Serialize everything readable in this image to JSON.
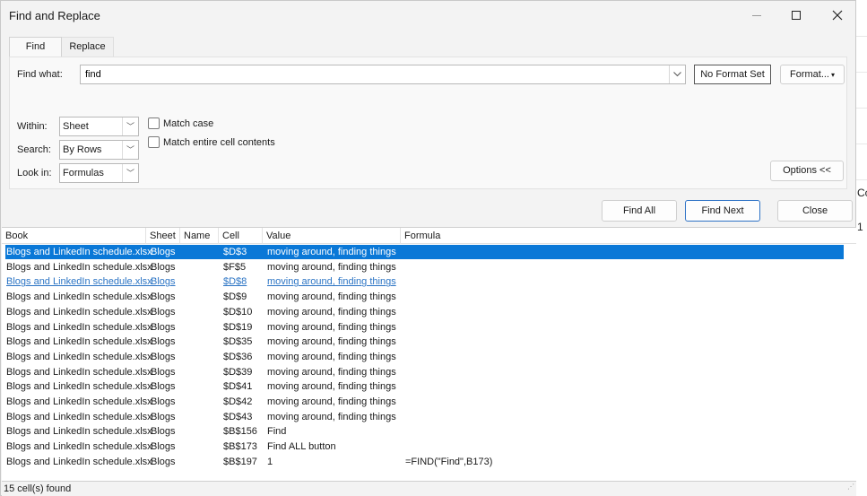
{
  "window": {
    "title": "Find and Replace"
  },
  "tabs": [
    {
      "label": "Find",
      "active": true
    },
    {
      "label": "Replace",
      "active": false
    }
  ],
  "find": {
    "label": "Find what:",
    "value": "find",
    "format_status": "No Format Set",
    "format_button": "Format..."
  },
  "options": {
    "within": {
      "label": "Within:",
      "value": "Sheet"
    },
    "search": {
      "label": "Search:",
      "value": "By Rows"
    },
    "lookin": {
      "label": "Look in:",
      "value": "Formulas"
    },
    "match_case": {
      "label": "Match case",
      "checked": false
    },
    "match_entire": {
      "label": "Match entire cell contents",
      "checked": false
    },
    "options_button": "Options <<"
  },
  "actions": {
    "find_all": "Find All",
    "find_next": "Find Next",
    "close": "Close"
  },
  "results": {
    "columns": [
      "Book",
      "Sheet",
      "Name",
      "Cell",
      "Value",
      "Formula"
    ],
    "rows": [
      {
        "book": "Blogs and LinkedIn schedule.xlsx",
        "sheet": "Blogs",
        "name": "",
        "cell": "$D$3",
        "value": "moving around, finding things",
        "formula": ""
      },
      {
        "book": "Blogs and LinkedIn schedule.xlsx",
        "sheet": "Blogs",
        "name": "",
        "cell": "$F$5",
        "value": "moving around, finding things",
        "formula": ""
      },
      {
        "book": "Blogs and LinkedIn schedule.xlsx",
        "sheet": "Blogs",
        "name": "",
        "cell": "$D$8",
        "value": "moving around, finding things",
        "formula": ""
      },
      {
        "book": "Blogs and LinkedIn schedule.xlsx",
        "sheet": "Blogs",
        "name": "",
        "cell": "$D$9",
        "value": "moving around, finding things",
        "formula": ""
      },
      {
        "book": "Blogs and LinkedIn schedule.xlsx",
        "sheet": "Blogs",
        "name": "",
        "cell": "$D$10",
        "value": "moving around, finding things",
        "formula": ""
      },
      {
        "book": "Blogs and LinkedIn schedule.xlsx",
        "sheet": "Blogs",
        "name": "",
        "cell": "$D$19",
        "value": "moving around, finding things",
        "formula": ""
      },
      {
        "book": "Blogs and LinkedIn schedule.xlsx",
        "sheet": "Blogs",
        "name": "",
        "cell": "$D$35",
        "value": "moving around, finding things",
        "formula": ""
      },
      {
        "book": "Blogs and LinkedIn schedule.xlsx",
        "sheet": "Blogs",
        "name": "",
        "cell": "$D$36",
        "value": "moving around, finding things",
        "formula": ""
      },
      {
        "book": "Blogs and LinkedIn schedule.xlsx",
        "sheet": "Blogs",
        "name": "",
        "cell": "$D$39",
        "value": "moving around, finding things",
        "formula": ""
      },
      {
        "book": "Blogs and LinkedIn schedule.xlsx",
        "sheet": "Blogs",
        "name": "",
        "cell": "$D$41",
        "value": "moving around, finding things",
        "formula": ""
      },
      {
        "book": "Blogs and LinkedIn schedule.xlsx",
        "sheet": "Blogs",
        "name": "",
        "cell": "$D$42",
        "value": "moving around, finding things",
        "formula": ""
      },
      {
        "book": "Blogs and LinkedIn schedule.xlsx",
        "sheet": "Blogs",
        "name": "",
        "cell": "$D$43",
        "value": "moving around, finding things",
        "formula": ""
      },
      {
        "book": "Blogs and LinkedIn schedule.xlsx",
        "sheet": "Blogs",
        "name": "",
        "cell": "$B$156",
        "value": "Find",
        "formula": ""
      },
      {
        "book": "Blogs and LinkedIn schedule.xlsx",
        "sheet": "Blogs",
        "name": "",
        "cell": "$B$173",
        "value": "Find ALL button",
        "formula": ""
      },
      {
        "book": "Blogs and LinkedIn schedule.xlsx",
        "sheet": "Blogs",
        "name": "",
        "cell": "$B$197",
        "value": "1",
        "formula": "=FIND(\"Find\",B173)"
      }
    ],
    "selected_index": 0,
    "hover_index": 2
  },
  "status": {
    "text": "15 cell(s) found"
  },
  "background": {
    "fragment_top": "Co",
    "fragment_bottom": "1"
  },
  "colors": {
    "selection": "#0a78d7",
    "link": "#2b74c4",
    "focus_border": "#2f73c6"
  }
}
